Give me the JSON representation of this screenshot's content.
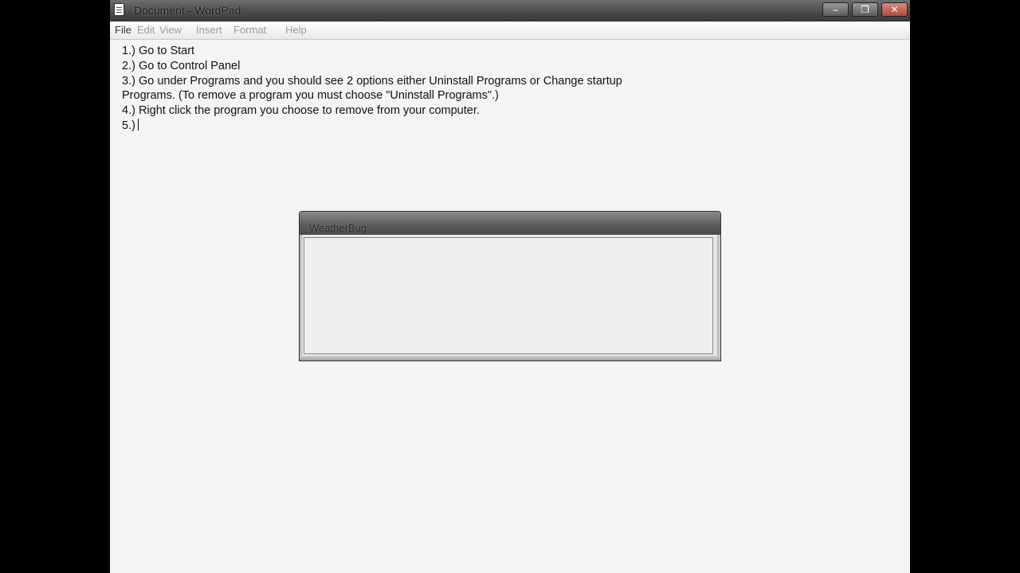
{
  "window": {
    "title": "Document - WordPad"
  },
  "menu": {
    "file": "File",
    "edit": "Edit",
    "view": "View",
    "insert": "Insert",
    "format": "Format",
    "help": "Help"
  },
  "document": {
    "lines": [
      "1.) Go to Start",
      "2.) Go to Control Panel",
      "3.) Go under Programs and you should see 2 options either Uninstall Programs or Change startup",
      "Programs. (To remove a program you must choose \"Uninstall Programs\".)",
      "4.) Right click the program you choose to remove from your computer.",
      "5.)"
    ]
  },
  "dialog": {
    "title": "WeatherBug"
  },
  "icons": {
    "app": "wordpad-document-icon",
    "minimize": "minimize-icon",
    "maximize": "restore-icon",
    "close": "close-icon"
  },
  "colors": {
    "titlebar": "#4a4a4a",
    "document_bg": "#f4f4f4",
    "text": "#111111",
    "close_button": "#b04a3c"
  }
}
